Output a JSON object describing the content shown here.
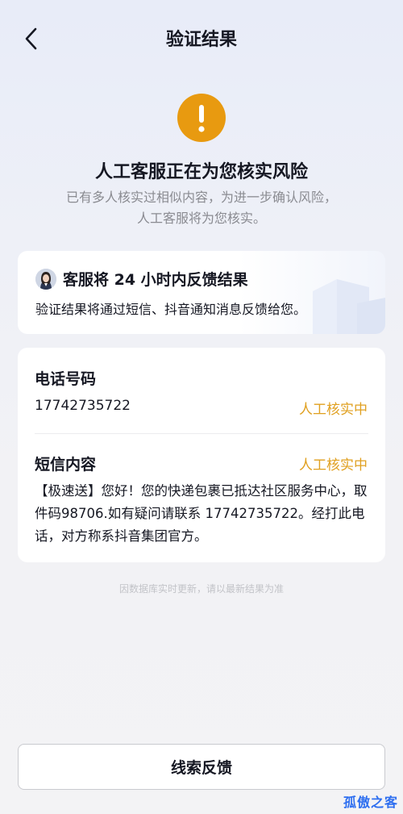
{
  "nav": {
    "title": "验证结果"
  },
  "notice": {
    "headline": "人工客服正在为您核实风险",
    "description_line1": "已有多人核实过相似内容，为进一步确认风险，",
    "description_line2": "人工客服将为您核实。"
  },
  "service_card": {
    "title": "客服将 24 小时内反馈结果",
    "subtitle": "验证结果将通过短信、抖音通知消息反馈给您。"
  },
  "info_card": {
    "phone_label": "电话号码",
    "phone_value": "17742735722",
    "phone_status": "人工核实中",
    "sms_label": "短信内容",
    "sms_status": "人工核实中",
    "sms_body": "【极速送】您好！您的快递包裹已抵达社区服务中心，取件码98706.如有疑问请联系 17742735722。经打此电话，对方称系抖音集团官方。"
  },
  "footnote": "因数据库实时更新，请以最新结果为准",
  "feedback_button": "线索反馈",
  "watermark": "孤傲之客",
  "colors": {
    "accent_warning": "#e89a10",
    "status_text": "#e0a020",
    "primary_text": "#161823",
    "secondary_text": "#8a8b91"
  }
}
